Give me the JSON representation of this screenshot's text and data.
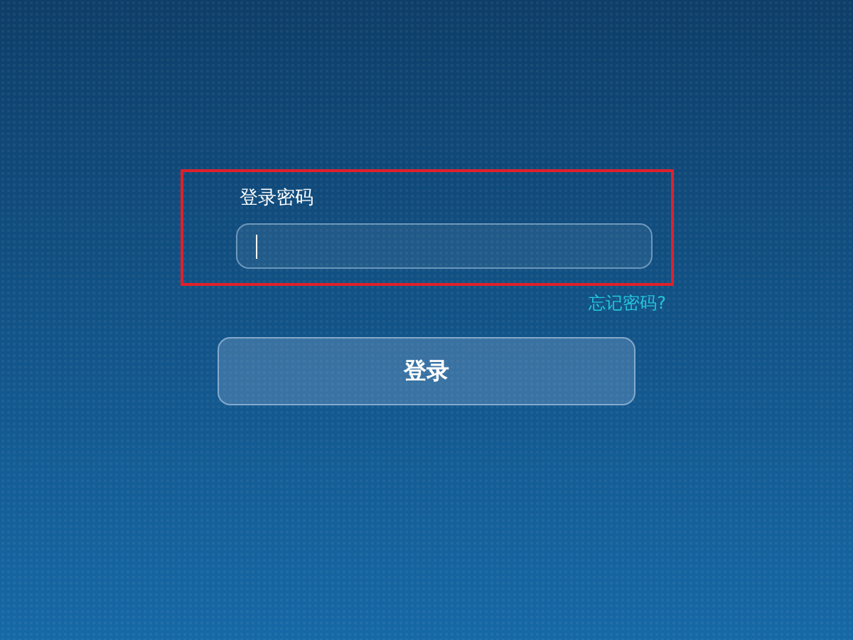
{
  "login_form": {
    "highlighted": true,
    "password": {
      "label": "登录密码",
      "focused": true
    },
    "forgot_link": "忘记密码?",
    "submit_button": "登录"
  }
}
